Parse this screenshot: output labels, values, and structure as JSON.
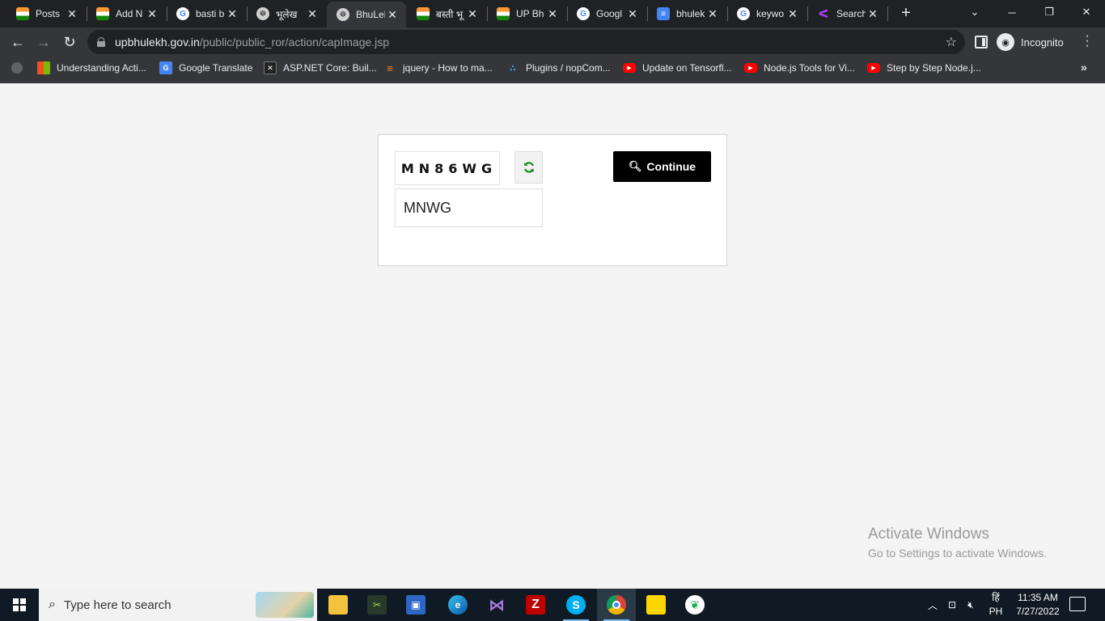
{
  "tabs": [
    {
      "title": "Posts",
      "icon": "india-flag-icon",
      "active": false
    },
    {
      "title": "Add N",
      "icon": "india-flag-icon",
      "active": false
    },
    {
      "title": "basti b",
      "icon": "google-icon",
      "active": false
    },
    {
      "title": "भूलेख",
      "icon": "up-emblem-icon",
      "active": false
    },
    {
      "title": "BhuLel",
      "icon": "up-emblem-icon",
      "active": true
    },
    {
      "title": "बस्ती भू",
      "icon": "india-flag-icon",
      "active": false
    },
    {
      "title": "UP Bh",
      "icon": "india-flag-icon",
      "active": false
    },
    {
      "title": "Googl",
      "icon": "google-icon",
      "active": false
    },
    {
      "title": "bhulek",
      "icon": "google-docs-icon",
      "active": false
    },
    {
      "title": "keywo",
      "icon": "google-icon",
      "active": false
    },
    {
      "title": "Search",
      "icon": "search-k-icon",
      "active": false
    }
  ],
  "address": {
    "host": "upbhulekh.gov.in",
    "path": "/public/public_ror/action/capImage.jsp"
  },
  "profile": {
    "label": "Incognito"
  },
  "bookmarks": [
    {
      "label": "Understanding Acti...",
      "icon": "microsoft-icon"
    },
    {
      "label": "Google Translate",
      "icon": "google-translate-icon"
    },
    {
      "label": "ASP.NET Core: Buil...",
      "icon": "aspnet-icon"
    },
    {
      "label": "jquery - How to ma...",
      "icon": "stackoverflow-icon"
    },
    {
      "label": "Plugins / nopCom...",
      "icon": "nopcommerce-icon"
    },
    {
      "label": "Update on Tensorfl...",
      "icon": "youtube-icon"
    },
    {
      "label": "Node.js Tools for Vi...",
      "icon": "youtube-icon"
    },
    {
      "label": "Step by Step Node.j...",
      "icon": "youtube-icon"
    }
  ],
  "captcha": {
    "image_text": "MN86WG",
    "input_value": "MNWG",
    "continue_label": "Continue",
    "refresh_icon": "refresh-icon",
    "refresh_color": "#1a8a1a"
  },
  "watermark": {
    "line1": "Activate Windows",
    "line2": "Go to Settings to activate Windows."
  },
  "taskbar": {
    "search_placeholder": "Type here to search",
    "lang_top": "हिं",
    "lang_bottom": "PH",
    "time": "11:35 AM",
    "date": "7/27/2022"
  }
}
